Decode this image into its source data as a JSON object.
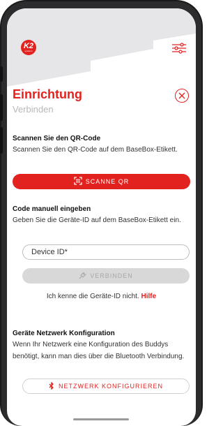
{
  "colors": {
    "brand": "#e2221f",
    "disabled_bg": "#d8d8d8",
    "disabled_text": "#a8a8a8",
    "header_bg": "#e6e6e8"
  },
  "logo": {
    "text": "K2",
    "subtext": "systems"
  },
  "page": {
    "title": "Einrichtung",
    "subtitle": "Verbinden"
  },
  "qr_section": {
    "heading": "Scannen Sie den QR-Code",
    "text": "Scannen Sie den QR-Code auf dem BaseBox-Etikett.",
    "button_label": "SCANNE QR",
    "button_icon": "qr-scan-icon"
  },
  "manual_section": {
    "heading": "Code manuell eingeben",
    "text": "Geben Sie die Geräte-ID auf dem BaseBox-Etikett ein.",
    "input_placeholder": "Device ID*",
    "connect_label": "VERBINDEN",
    "connect_icon": "plug-icon",
    "help_text": "Ich kenne die Geräte-ID nicht.",
    "help_link": "Hilfe"
  },
  "network_section": {
    "heading": "Geräte Netzwerk Konfiguration",
    "text": "Wenn Ihr Netzwerk eine Konfiguration des Buddys benötigt, kann man dies über die Bluetooth Verbindung.",
    "button_label": "NETZWERK KONFIGURIEREN",
    "button_icon": "bluetooth-icon"
  }
}
